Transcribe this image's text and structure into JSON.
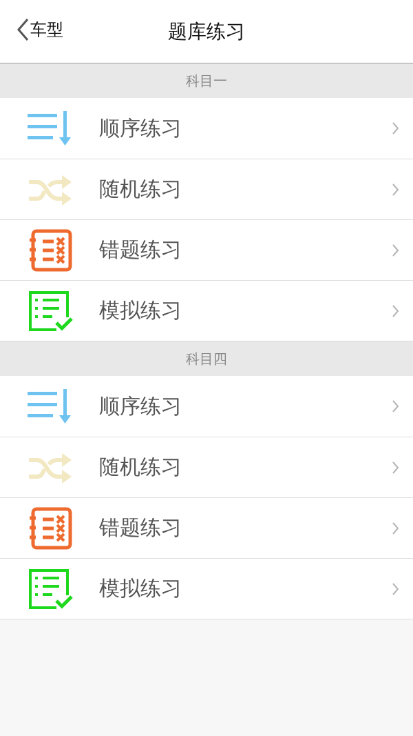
{
  "nav_bar": {
    "back": "车型",
    "title": "题库练习"
  },
  "sections": [
    {
      "title": "科目一",
      "items": [
        {
          "kind": "sequence",
          "label": "顺序练习"
        },
        {
          "kind": "random",
          "label": "随机练习"
        },
        {
          "kind": "mistakes",
          "label": "错题练习"
        },
        {
          "kind": "mock",
          "label": "模拟练习"
        }
      ]
    },
    {
      "title": "科目四",
      "items": [
        {
          "kind": "sequence",
          "label": "顺序练习"
        },
        {
          "kind": "random",
          "label": "随机练习"
        },
        {
          "kind": "mistakes",
          "label": "错题练习"
        },
        {
          "kind": "mock",
          "label": "模拟练习"
        }
      ]
    }
  ]
}
